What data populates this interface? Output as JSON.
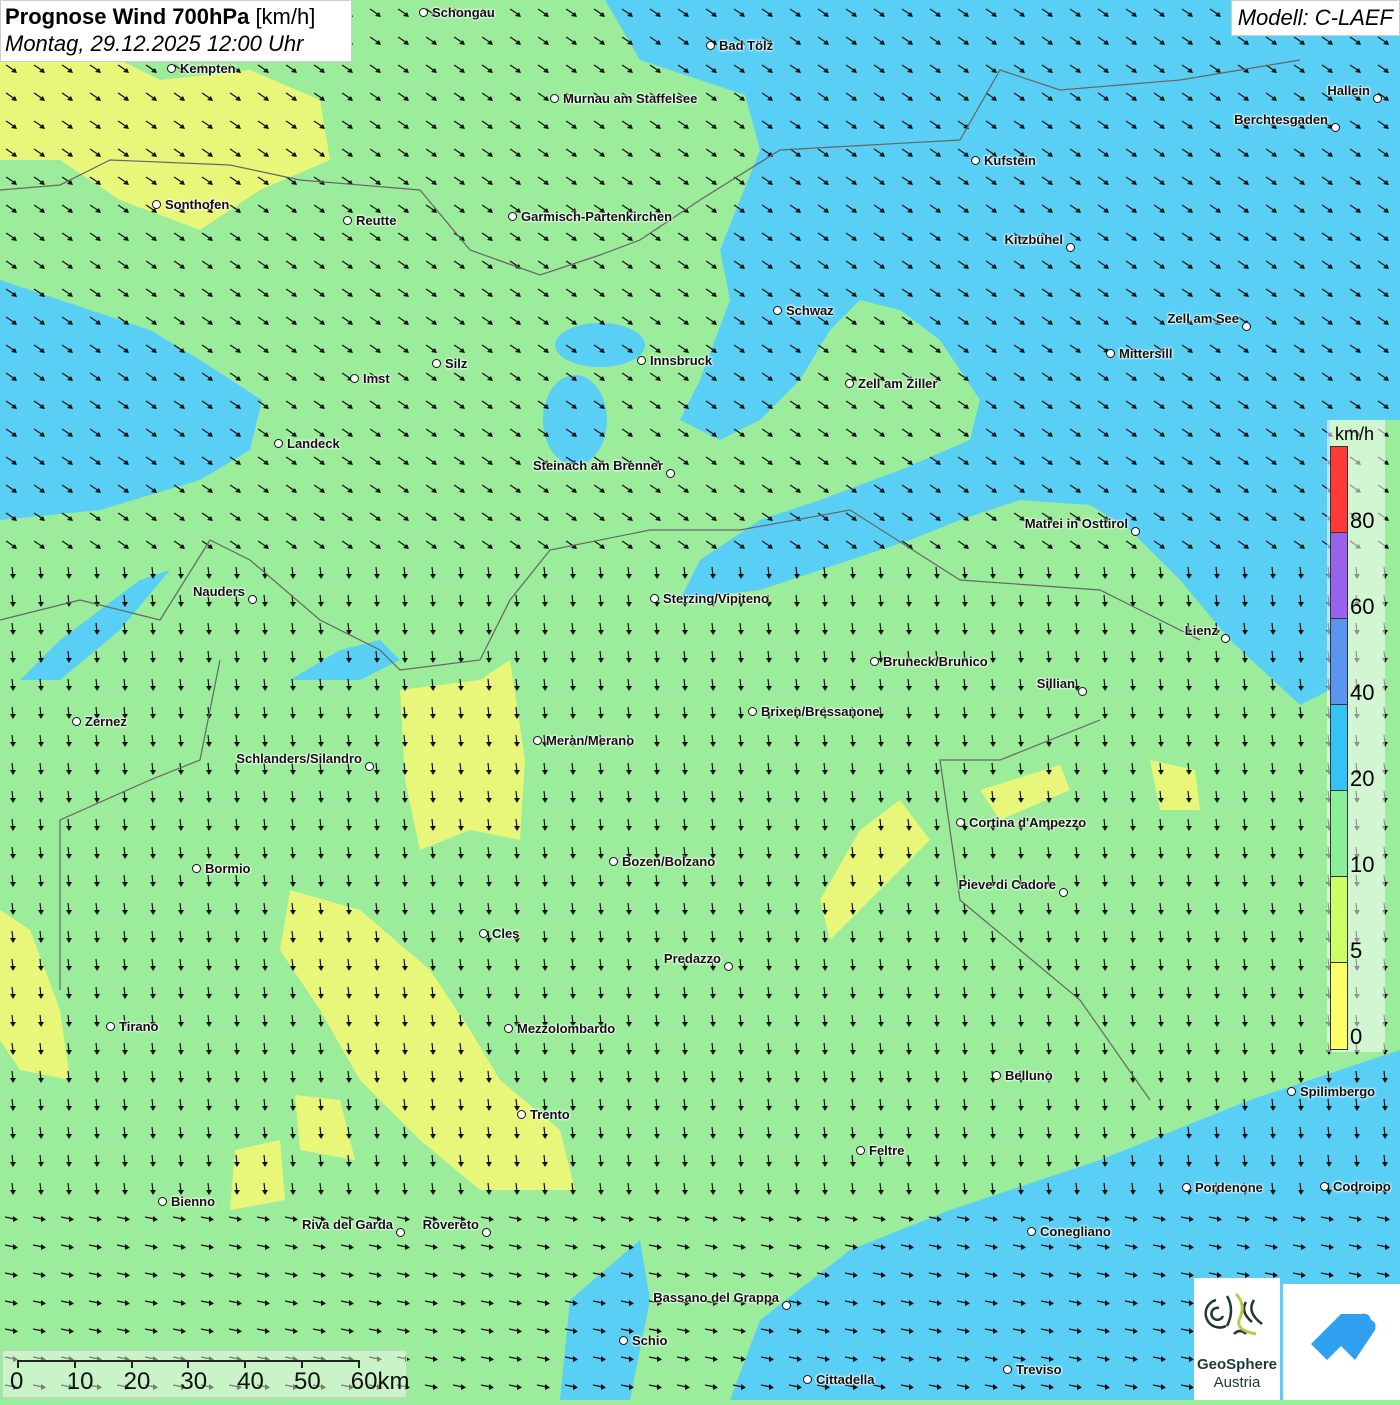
{
  "header": {
    "title_bold": "Prognose Wind 700hPa",
    "title_unit": "[km/h]",
    "date": "Montag, 29.12.2025 12:00 Uhr",
    "model": "Modell: C-LAEF"
  },
  "legend": {
    "unit": "km/h",
    "labels": [
      "80",
      "60",
      "40",
      "20",
      "10",
      "5",
      "0"
    ],
    "colors": {
      "c80": "#ff3838",
      "c60": "#9a63ee",
      "c40": "#5a96f0",
      "c20": "#33c3f6",
      "c10": "#8af09a",
      "c5": "#ccff66",
      "c0": "#ffff66"
    }
  },
  "map_colors": {
    "base": "#9bec9b",
    "blue": "#5acff5",
    "yellow": "#e8f77a"
  },
  "cities": [
    "Schongau",
    "Bad Tölz",
    "Kempten",
    "Murnau am Staffelsee",
    "Hallein",
    "Berchtesgaden",
    "Kufstein",
    "Sonthofen",
    "Reutte",
    "Garmisch-Partenkirchen",
    "Kitzbühel",
    "Schwaz",
    "Zell am See",
    "Mittersill",
    "Innsbruck",
    "Silz",
    "Imst",
    "Zell am Ziller",
    "Landeck",
    "Steinach am Brenner",
    "Matrei in Osttirol",
    "Nauders",
    "Sterzing/Vipiteno",
    "Lienz",
    "Bruneck/Brunico",
    "Sillian",
    "Brixen/Bressanone",
    "Zernez",
    "Meran/Merano",
    "Schlanders/Silandro",
    "Cortina d'Ampezzo",
    "Bozen/Bolzano",
    "Bormio",
    "Pieve di Cadore",
    "Cles",
    "Predazzo",
    "Tirano",
    "Mezzolombardo",
    "Belluno",
    "Spilimbergo",
    "Trento",
    "Feltre",
    "Pordenone",
    "Codroipo",
    "Bienno",
    "Riva del Garda",
    "Rovereto",
    "Conegliano",
    "Bassano del Grappa",
    "Schio",
    "Treviso",
    "Cittadella"
  ],
  "scale": {
    "labels": [
      "0",
      "10",
      "20",
      "30",
      "40",
      "50",
      "60km"
    ]
  },
  "logos": {
    "geosphere_line1": "GeoSphere",
    "geosphere_line2": "Austria"
  }
}
